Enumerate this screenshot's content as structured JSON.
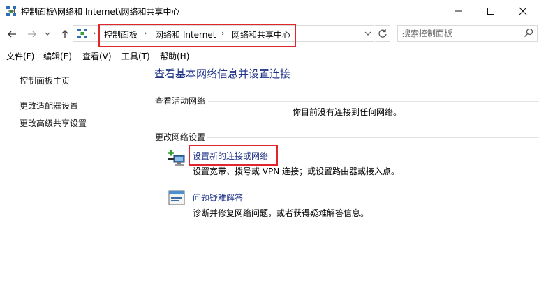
{
  "window": {
    "title": "控制面板\\网络和 Internet\\网络和共享中心",
    "icons": {
      "app": "network-center-icon",
      "minimize": "minimize-icon",
      "maximize": "maximize-icon",
      "close": "close-icon"
    }
  },
  "address_bar": {
    "breadcrumbs": [
      "控制面板",
      "网络和 Internet",
      "网络和共享中心"
    ],
    "separator": "›",
    "icons": {
      "back": "arrow-left-icon",
      "forward": "arrow-right-icon",
      "recent": "chevron-down-icon",
      "up": "arrow-up-icon",
      "location": "control-panel-icon",
      "refresh": "refresh-icon"
    }
  },
  "search": {
    "placeholder": "搜索控制面板",
    "value": "",
    "icon": "search-icon"
  },
  "menu": {
    "items": [
      "文件(F)",
      "编辑(E)",
      "查看(V)",
      "工具(T)",
      "帮助(H)"
    ]
  },
  "left_pane": {
    "links": [
      "控制面板主页",
      "更改适配器设置",
      "更改高级共享设置"
    ]
  },
  "main": {
    "title": "查看基本网络信息并设置连接",
    "active_networks": {
      "heading": "查看活动网络",
      "status": "你目前没有连接到任何网络。"
    },
    "change_settings": {
      "heading": "更改网络设置",
      "tasks": [
        {
          "label": "设置新的连接或网络",
          "description": "设置宽带、拨号或 VPN 连接；或设置路由器或接入点。",
          "icon": "new-connection-icon"
        },
        {
          "label": "问题疑难解答",
          "description": "诊断并修复网络问题，或者获得疑难解答信息。",
          "icon": "troubleshoot-icon"
        }
      ]
    }
  },
  "colors": {
    "link": "#1e3287",
    "highlight_box": "#e2252b"
  }
}
